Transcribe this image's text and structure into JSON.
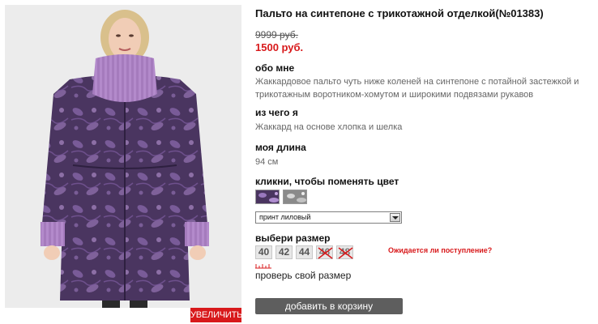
{
  "product": {
    "title": "Пальто на синтепоне с трикотажной отделкой(№01383)",
    "old_price": "9999 руб.",
    "new_price": "1500 руб.",
    "about_heading": "обо мне",
    "about_line1": "Жаккардовое пальто чуть ниже коленей на синтепоне с потайной застежкой и",
    "about_line2": "трикотажным воротником-хомутом и широкими подвязами рукавов",
    "material_heading": "из чего я",
    "material_text": "Жаккард на основе хлопка и шелка",
    "length_heading": "моя длина",
    "length_text": "94 см"
  },
  "photo": {
    "zoom_label": "УВЕЛИЧИТЬ"
  },
  "color": {
    "heading": "кликни, чтобы поменять цвет",
    "swatches": [
      {
        "name": "purple-print",
        "color": "#4a3560"
      },
      {
        "name": "grey-print",
        "color": "#9a9a9a"
      }
    ],
    "selected": "принт лиловый"
  },
  "size": {
    "heading": "выбери размер",
    "options": [
      {
        "label": "40",
        "available": true
      },
      {
        "label": "42",
        "available": true
      },
      {
        "label": "44",
        "available": true
      },
      {
        "label": "46",
        "available": false
      },
      {
        "label": "48",
        "available": false
      }
    ],
    "await_link": "Ожидается ли поступление?",
    "check_size": "проверь свой размер"
  },
  "cart": {
    "button_label": "добавить в корзину"
  },
  "colors": {
    "accent": "#d8191b",
    "cart_button": "#5e5e5e",
    "coat": "#4a3560",
    "scarf": "#b38acb"
  }
}
